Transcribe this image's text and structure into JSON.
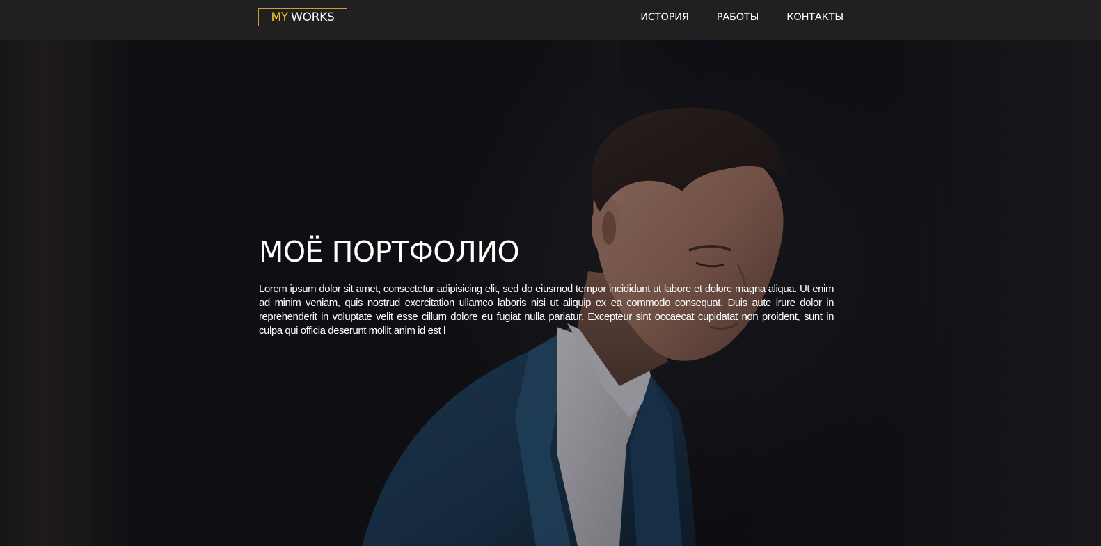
{
  "header": {
    "logo": {
      "part1": "MY",
      "part2": "WORKS"
    },
    "nav": [
      {
        "label": "ИСТОРИЯ"
      },
      {
        "label": "РАБОТЫ"
      },
      {
        "label": "КОНТАКТЫ"
      }
    ]
  },
  "hero": {
    "title": "МОЁ ПОРТФОЛИО",
    "text": "Lorem ipsum dolor sit amet, consectetur adipisicing elit, sed do eiusmod tempor incididunt ut labore et dolore magna aliqua. Ut enim ad minim veniam, quis nostrud exercitation ullamco laboris nisi ut aliquip ex ea commodo consequat. Duis aute irure dolor in reprehenderit in voluptate velit esse cillum dolore eu fugiat nulla pariatur. Excepteur sint occaecat cupidatat non proident, sunt in culpa qui officia deserunt mollit anim id est l"
  },
  "colors": {
    "header_bg": "#1f201f",
    "accent": "#f2c230",
    "text": "#ffffff"
  }
}
